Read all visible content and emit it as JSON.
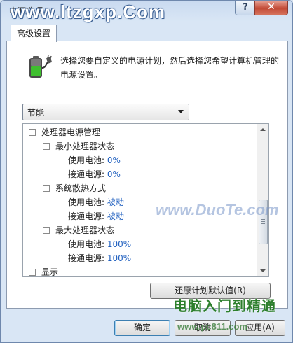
{
  "window": {
    "title": "电源选项",
    "help_label": "?",
    "close_label": "✕"
  },
  "watermarks": {
    "top": "www.ltzgxp.Com",
    "middle": "www.DuoTe.com",
    "bottom_right": "电脑入门到精通",
    "bottom_right_sub": "www.pc811.com"
  },
  "tabs": [
    {
      "label": "高级设置"
    }
  ],
  "description": "选择您要自定义的电源计划，然后选择您希望计算机管理的电源设置。",
  "plan_select": {
    "value": "节能"
  },
  "tree": {
    "processor": {
      "label": "处理器电源管理"
    },
    "min_state": {
      "label": "最小处理器状态",
      "battery_label": "使用电池:",
      "battery_value": "0%",
      "plugged_label": "接通电源:",
      "plugged_value": "0%"
    },
    "cooling": {
      "label": "系统散热方式",
      "battery_label": "使用电池:",
      "battery_value": "被动",
      "plugged_label": "接通电源:",
      "plugged_value": "被动"
    },
    "max_state": {
      "label": "最大处理器状态",
      "battery_label": "使用电池:",
      "battery_value": "100%",
      "plugged_label": "接通电源:",
      "plugged_value": "100%"
    },
    "display": {
      "label": "显示"
    }
  },
  "buttons": {
    "restore": "还原计划默认值(R)",
    "ok": "确定",
    "cancel": "取消",
    "apply": "应用(A)"
  },
  "colors": {
    "value_text": "#1f5fbf",
    "title_bar": "#c9daf0",
    "close_button": "#c24a36"
  },
  "icons": [
    "battery-plug-icon",
    "help-icon",
    "close-icon",
    "chevron-down-icon"
  ]
}
